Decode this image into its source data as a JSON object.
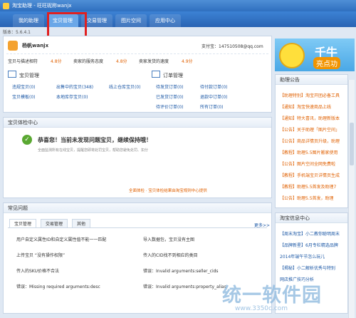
{
  "window": {
    "title": "淘宝助理 - 旺旺昵称wanjx"
  },
  "nav": {
    "tabs": [
      "我的助理",
      "宝贝管理",
      "交易管理",
      "图片空间",
      "应用中心"
    ],
    "active_index": 1
  },
  "version": "版本：5.6.4.1",
  "account": {
    "name": "杨帆wanjx",
    "alipay_label": "支付宝：147510508@qq.com",
    "ratings": [
      {
        "label": "宝贝与描述相符",
        "value": "4.8分"
      },
      {
        "label": "卖家的服务态度",
        "value": "4.8分"
      },
      {
        "label": "卖家发货的速度",
        "value": "4.9分"
      }
    ]
  },
  "goods": {
    "title": "宝贝管理",
    "items": [
      {
        "label": "违规宝贝(0)"
      },
      {
        "label": "出售中的宝贝(348)"
      },
      {
        "label": "线上仓库宝贝(0)"
      },
      {
        "label": "宝贝模板(0)"
      },
      {
        "label": "本地库存宝贝(0)"
      }
    ]
  },
  "orders": {
    "title": "订单管理",
    "items": [
      {
        "label": "待发货订单(0)"
      },
      {
        "label": "待付款订单(0)"
      },
      {
        "label": "已发货订单(0)"
      },
      {
        "label": "退款中订单(0)"
      },
      {
        "label": "待评价订单(0)"
      },
      {
        "label": "所有订单(0)"
      }
    ]
  },
  "health": {
    "title": "宝贝体检中心",
    "headline": "恭喜您！当前未发现问题宝贝，继续保持哦！",
    "desc": "全面监测所有在线宝贝，提醒您即将处罚宝贝，帮助您避免处罚、扣分",
    "footer": "全面体检 · 宝贝体检结果由淘宝规则中心提供"
  },
  "problems": {
    "title": "常见问题",
    "tabs": [
      "宝贝管理",
      "交易管理",
      "其他"
    ],
    "more": "更多>>",
    "items": [
      "用户自定义属性ID和自定义属性值不能一一匹配",
      "导入数据包，宝贝没有主图",
      "上传宝贝 “没有操作权限”",
      "传入的CID找不到相应的类目",
      "传入的SKU价格不合法",
      "错误：Invalid arguments:seller_cids",
      "错误：Missing required arguments:desc",
      "错误：Invalid arguments:property_alias"
    ]
  },
  "banner": {
    "title": "千牛",
    "subtitle": "亮点功"
  },
  "announce": {
    "title": "助理公告",
    "items": [
      "【助理特别】淘宝开团必备工具",
      "【通知】淘宝快速商品上线",
      "【通知】特大喜讯，助理新版本",
      "【公告】关于助理「图片空间」",
      "【公告】商品详情页升级，助理",
      "【教程】助理5.5图片搬家使用",
      "【公告】图片空间全网免费啦",
      "【教程】手机端宝贝详情页生成",
      "【教程】助理5.5首发及助理7",
      "【公告】助理5.5首发，助理"
    ]
  },
  "news": {
    "title": "淘宝信息中心",
    "items": [
      "【周末淘宝】小二教你聪明周末",
      "【品牌新星】6月专栏精选品牌",
      "2014年端午节怎么玩儿",
      "【揭秘】小二解析优秀与特别",
      "网店推广技巧分析"
    ]
  },
  "colors": {
    "nav_blue": "#2f6fbf",
    "highlight_red": "#e02020",
    "link_blue": "#1c58a6",
    "accent_orange": "#e06000",
    "success_green": "#5aa832"
  }
}
